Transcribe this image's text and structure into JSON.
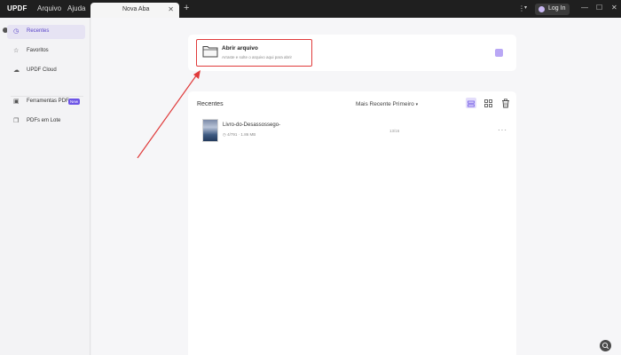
{
  "titlebar": {
    "brand": "UPDF",
    "menu": [
      "Arquivo",
      "Ajuda"
    ],
    "tab_label": "Nova Aba",
    "tab_close": "✕",
    "new_tab": "+",
    "login_label": "Log In",
    "controls": {
      "minimize": "—",
      "maximize": "☐",
      "close": "✕"
    }
  },
  "sidebar": {
    "items": [
      {
        "label": "Recentes",
        "icon": "clock-icon"
      },
      {
        "label": "Favoritos",
        "icon": "star-icon"
      },
      {
        "label": "UPDF Cloud",
        "icon": "cloud-icon"
      },
      {
        "label": "Ferramentas PDF",
        "icon": "toolbox-icon",
        "badge": "New"
      },
      {
        "label": "PDFs em Lote",
        "icon": "stack-icon"
      }
    ]
  },
  "open_card": {
    "title": "Abrir arquivo",
    "subtitle": "Arraste e solte o arquivo aqui para abrir"
  },
  "recent": {
    "title": "Recentes",
    "sort_label": "Mais Recente Primeiro",
    "files": [
      {
        "name": "Livro-do-Desassossego-",
        "meta": "◷ 4/791  ·  1.86 MB",
        "pages": "13/16",
        "more": "···"
      }
    ]
  },
  "colors": {
    "accent": "#6d55e6",
    "highlight": "#e03b3b",
    "titlebar": "#1f1f1f"
  }
}
